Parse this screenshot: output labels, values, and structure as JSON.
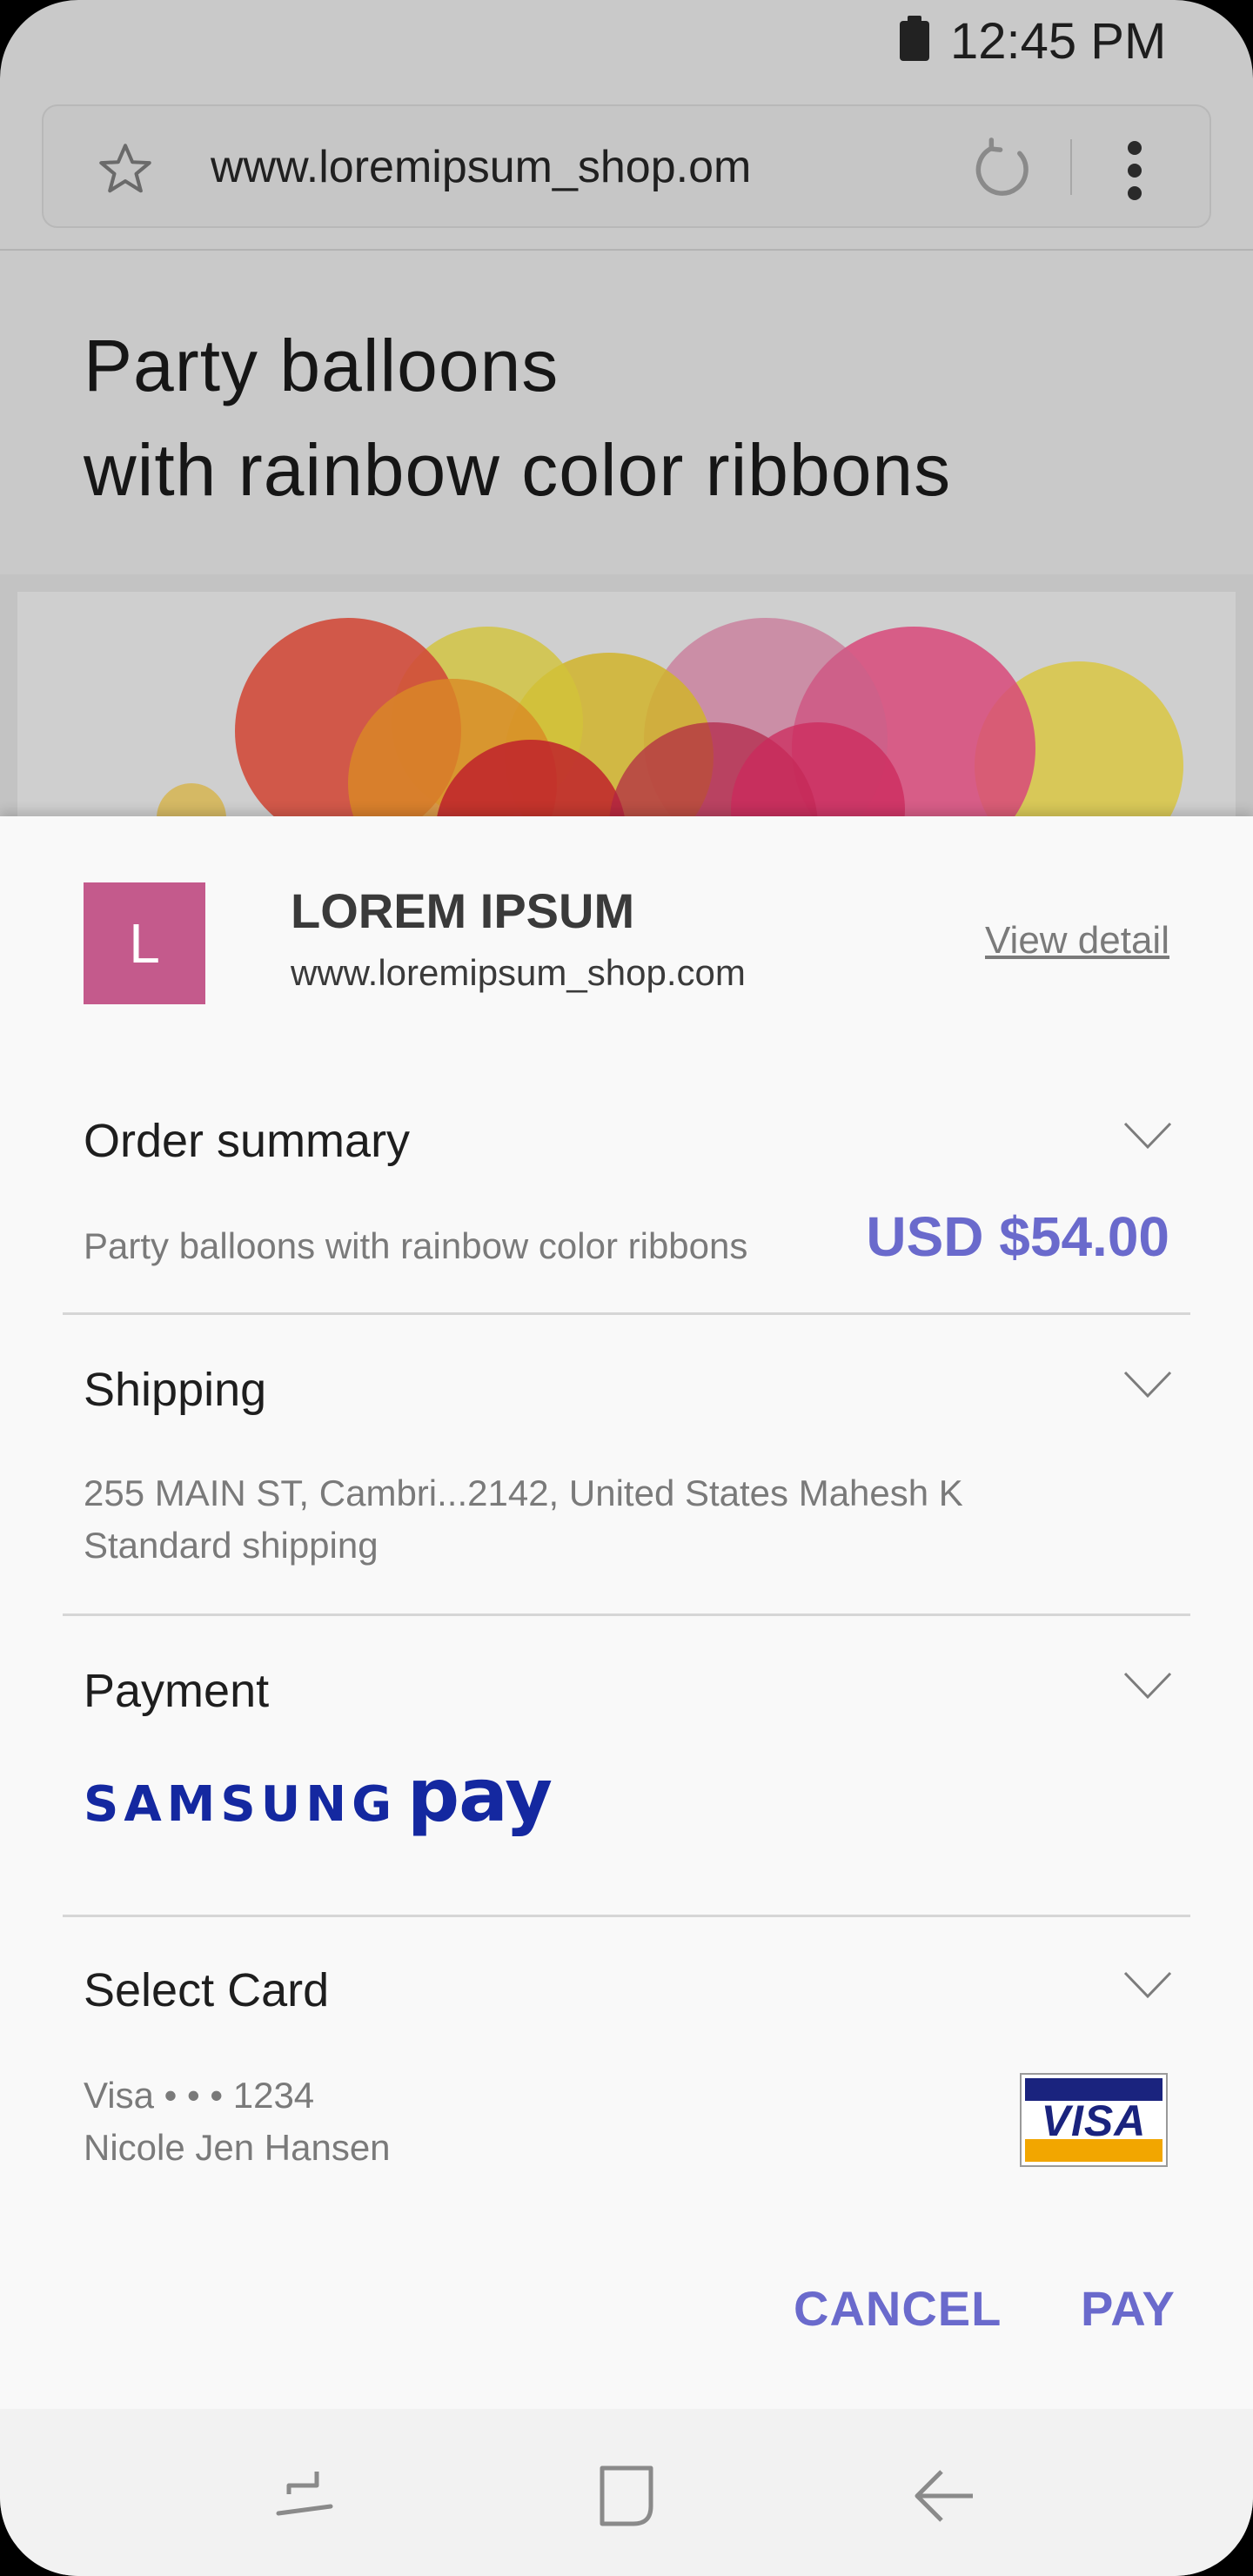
{
  "status_bar": {
    "time": "12:45 PM"
  },
  "browser": {
    "url": "www.loremipsum_shop.om"
  },
  "product": {
    "title_line1": "Party balloons",
    "title_line2": "with rainbow color ribbons"
  },
  "merchant": {
    "avatar_letter": "L",
    "name": "LOREM IPSUM",
    "url": "www.loremipsum_shop.com",
    "view_detail_label": "View detail"
  },
  "order_summary": {
    "title": "Order summary",
    "item": "Party balloons with rainbow color ribbons",
    "amount": "USD $54.00"
  },
  "shipping": {
    "title": "Shipping",
    "address": "255 MAIN ST, Cambri...2142, United States Mahesh K",
    "method": "Standard shipping"
  },
  "payment": {
    "title": "Payment",
    "brand_samsung": "SAMSUNG",
    "brand_pay": "pay"
  },
  "card": {
    "title": "Select Card",
    "number": "Visa • • • 1234",
    "holder": "Nicole Jen Hansen",
    "brand_label": "VISA"
  },
  "actions": {
    "cancel": "CANCEL",
    "pay": "PAY"
  },
  "colors": {
    "accent": "#6a6acc",
    "merchant_avatar": "#c45a8c",
    "samsung_pay_blue": "#1428a0",
    "visa_blue": "#1a237e",
    "visa_gold": "#f2a600"
  },
  "icons": {
    "battery": "battery-icon",
    "bookmark": "star-icon",
    "reload": "reload-icon",
    "overflow": "more-vert-icon",
    "expand": "chevron-down-icon",
    "recents": "recents-icon",
    "home": "home-icon",
    "back": "back-icon"
  }
}
